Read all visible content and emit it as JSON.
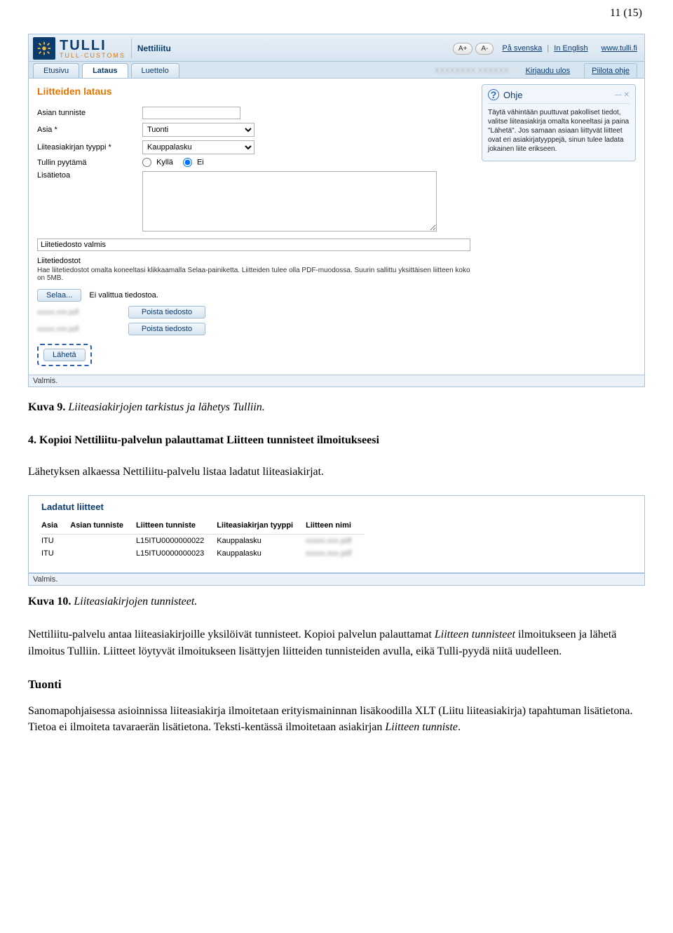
{
  "page": {
    "number": "11 (15)"
  },
  "header": {
    "brand": "TULLI",
    "subbrand": "TULL·CUSTOMS",
    "app_name": "Nettiliitu",
    "zoom_in": "A+",
    "zoom_out": "A-",
    "lang_sv": "På svenska",
    "lang_en": "In English",
    "site_link": "www.tulli.fi"
  },
  "tabs": {
    "home": "Etusivu",
    "upload": "Lataus",
    "list": "Luettelo"
  },
  "subheader": {
    "faded_user": "XXXXXXXX XXXXXX",
    "logout": "Kirjaudu ulos",
    "hide_help": "Piilota ohje"
  },
  "form": {
    "section_title": "Liitteiden lataus",
    "asian_tunniste_label": "Asian tunniste",
    "asia_label": "Asia *",
    "asia_value": "Tuonti",
    "tyyppi_label": "Liiteasiakirjan tyyppi *",
    "tyyppi_value": "Kauppalasku",
    "pyytama_label": "Tullin pyytämä",
    "kylla": "Kyllä",
    "ei": "Ei",
    "lisatietoa_label": "Lisätietoa",
    "status_text": "Liitetiedosto valmis",
    "lt_head": "Liitetiedostot",
    "lt_desc": "Hae liitetiedostot omalta koneeltasi klikkaamalla Selaa-painiketta. Liitteiden tulee olla PDF-muodossa. Suurin sallittu yksittäisen liitteen koko on 5MB.",
    "browse": "Selaa...",
    "no_file": "Ei valittua tiedostoa.",
    "del_file": "Poista tiedosto",
    "send": "Lähetä"
  },
  "help": {
    "title": "Ohje",
    "body": "Täytä vähintään puuttuvat pakolliset tiedot, valitse liiteasiakirja omalta koneeltasi ja paina \"Lähetä\". Jos samaan asiaan liittyvät liitteet ovat eri asiakirjatyyppejä, sinun tulee ladata jokainen liite erikseen."
  },
  "footer_status": "Valmis.",
  "cap1_strong": "Kuva 9.",
  "cap1_rest": " Liiteasiakirjojen tarkistus ja lähetys Tulliin.",
  "step4_title": "4. Kopioi Nettiliitu-palvelun palauttamat Liitteen tunnisteet ilmoitukseesi",
  "step4_body": "Lähetyksen alkaessa Nettiliitu-palvelu listaa ladatut liiteasiakirjat.",
  "list_panel": {
    "title": "Ladatut liitteet",
    "cols": {
      "asia": "Asia",
      "asian_tunniste": "Asian tunniste",
      "liitteen_tunniste": "Liitteen tunniste",
      "tyyppi": "Liiteasiakirjan tyyppi",
      "nimi": "Liitteen nimi"
    },
    "rows": [
      {
        "asia": "ITU",
        "asian_tunniste": "",
        "liitteen_tunniste": "L15ITU0000000022",
        "tyyppi": "Kauppalasku",
        "nimi": "xxxxx.xxx.pdf"
      },
      {
        "asia": "ITU",
        "asian_tunniste": "",
        "liitteen_tunniste": "L15ITU0000000023",
        "tyyppi": "Kauppalasku",
        "nimi": "xxxxx.xxx.pdf"
      }
    ]
  },
  "cap2_strong": "Kuva 10.",
  "cap2_rest": " Liiteasiakirjojen tunnisteet.",
  "para1": "Nettiliitu-palvelu antaa liiteasiakirjoille yksilöivät tunnisteet. Kopioi palvelun palauttamat Liitteen tunnisteet ilmoitukseen ja lähetä ilmoitus Tulliin. Liitteet löytyvät ilmoitukseen lisättyjen liitteiden tunnisteiden avulla, eikä Tulli-pyydä niitä uudelleen.",
  "h3": "Tuonti",
  "para2": "Sanomapohjaisessa asioinnissa liiteasiakirja ilmoitetaan erityismaininnan lisäkoodilla XLT (Liitu liiteasiakirja) tapahtuman lisätietona. Tietoa ei ilmoiteta tavaraerän lisätietona. Teksti-kentässä ilmoitetaan asiakirjan Liitteen tunniste."
}
